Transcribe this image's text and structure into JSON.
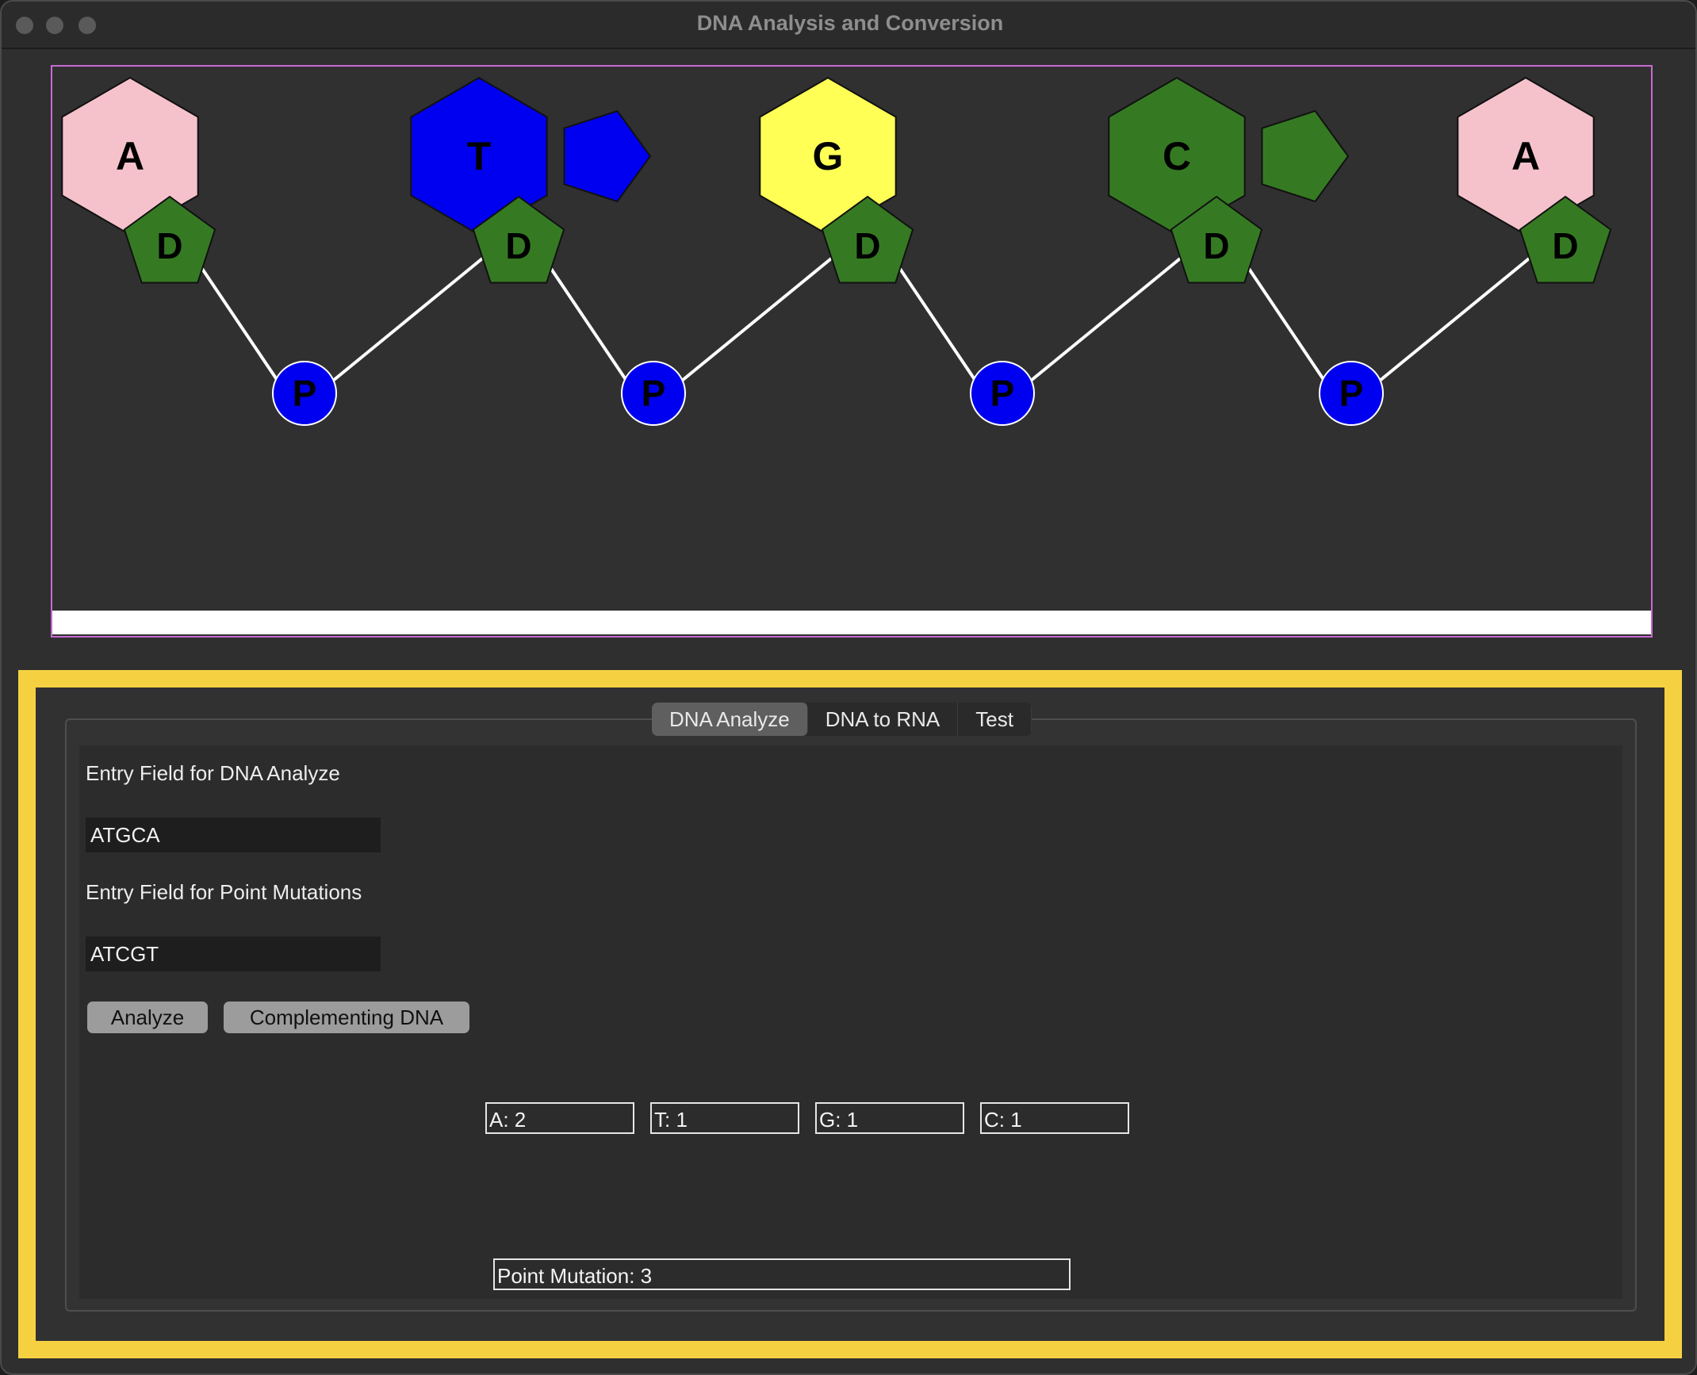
{
  "window": {
    "title": "DNA Analysis and Conversion"
  },
  "canvas": {
    "nucleotides": [
      {
        "base": "A",
        "base_color": "#f5c2cc",
        "sugar": "D",
        "phosphate": "P",
        "purine_ring": false
      },
      {
        "base": "T",
        "base_color": "#0000f0",
        "sugar": "D",
        "phosphate": "P",
        "purine_ring": true
      },
      {
        "base": "G",
        "base_color": "#ffff55",
        "sugar": "D",
        "phosphate": "P",
        "purine_ring": false
      },
      {
        "base": "C",
        "base_color": "#357a23",
        "sugar": "D",
        "phosphate": "P",
        "purine_ring": true
      },
      {
        "base": "A",
        "base_color": "#f5c2cc",
        "sugar": "D",
        "phosphate": null,
        "purine_ring": false
      }
    ],
    "sugar_color": "#357a23",
    "phosphate_color": "#0000f0"
  },
  "tabs": [
    {
      "label": "DNA Analyze",
      "active": true
    },
    {
      "label": "DNA to RNA",
      "active": false
    },
    {
      "label": "Test",
      "active": false
    }
  ],
  "dna_analyze": {
    "dna_label": "Entry Field for DNA Analyze",
    "dna_value": "ATGCA",
    "mutation_label": "Entry Field for Point Mutations",
    "mutation_value": "ATCGT",
    "analyze_button": "Analyze",
    "complement_button": "Complementing DNA",
    "counts": {
      "a": "A: 2",
      "t": "T: 1",
      "g": "G: 1",
      "c": "C: 1"
    },
    "point_mutation": "Point Mutation: 3"
  }
}
